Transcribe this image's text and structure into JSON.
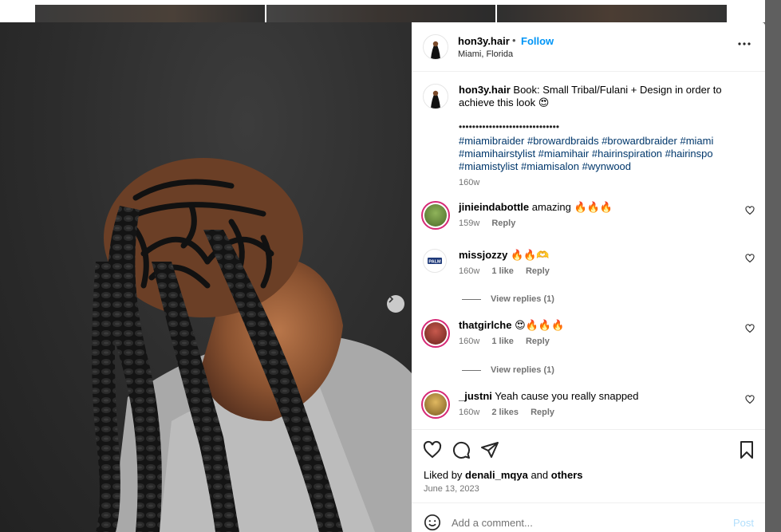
{
  "post": {
    "username": "hon3y.hair",
    "follow_label": "Follow",
    "separator": "•",
    "location": "Miami, Florida",
    "caption_user": "hon3y.hair",
    "caption_text": "Book: Small Tribal/Fulani + Design in order to achieve this look 😍",
    "caption_dots": "••••••••••••••••••••••••••••••",
    "hashtags": "#miamibraider #browardbraids #browardbraider #miami #miamihairstylist #miamihair #hairinspiration #hairinspo #miamistylist #miamisalon #wynwood",
    "caption_time": "160w"
  },
  "comments": [
    {
      "user": "jinieindabottle",
      "text": "amazing 🔥🔥🔥",
      "time": "159w",
      "likes": "",
      "reply": "Reply",
      "avatar_color": "#6b8f3a"
    },
    {
      "user": "missjozzy",
      "text": "🔥🔥🫶",
      "time": "160w",
      "likes": "1 like",
      "reply": "Reply",
      "avatar_color": "#1f3a7a",
      "avatar_text": "PALM",
      "replies": "View replies (1)"
    },
    {
      "user": "thatgirlche",
      "text": "😍🔥🔥🔥",
      "time": "160w",
      "likes": "1 like",
      "reply": "Reply",
      "avatar_color": "#a8433a",
      "replies": "View replies (1)"
    },
    {
      "user": "_justni",
      "text": "Yeah cause you really snapped",
      "time": "160w",
      "likes": "2 likes",
      "reply": "Reply",
      "avatar_color": "#c79a3a"
    }
  ],
  "likes": {
    "prefix": "Liked by",
    "user": "denali_mqya",
    "mid": "and",
    "others": "others"
  },
  "date": "June 13, 2023",
  "add_comment": {
    "placeholder": "Add a comment...",
    "post_label": "Post"
  },
  "colors": {
    "link": "#0095f6",
    "hashtag": "#00376b",
    "story_ring": "#d62976"
  },
  "icons": [
    "more-options-icon",
    "heart-icon",
    "comment-icon",
    "share-icon",
    "bookmark-icon",
    "emoji-icon",
    "chevron-right-icon"
  ]
}
